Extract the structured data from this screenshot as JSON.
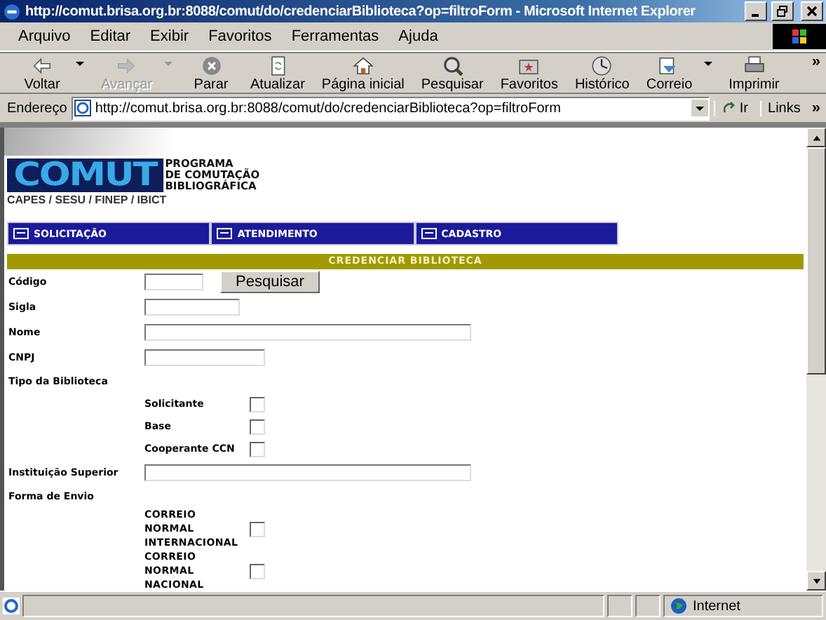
{
  "window": {
    "title": "http://comut.brisa.org.br:8088/comut/do/credenciarBiblioteca?op=filtroForm - Microsoft Internet Explorer"
  },
  "menu": [
    "Arquivo",
    "Editar",
    "Exibir",
    "Favoritos",
    "Ferramentas",
    "Ajuda"
  ],
  "toolbar": [
    {
      "kind": "back",
      "label": "Voltar",
      "disabled": false,
      "dropdown": true
    },
    {
      "kind": "forward",
      "label": "Avançar",
      "disabled": true,
      "dropdown": true
    },
    {
      "kind": "stop",
      "label": "Parar",
      "disabled": false,
      "dropdown": false
    },
    {
      "kind": "refresh",
      "label": "Atualizar",
      "disabled": false,
      "dropdown": false
    },
    {
      "kind": "home",
      "label": "Página inicial",
      "disabled": false,
      "dropdown": false
    },
    {
      "kind": "search",
      "label": "Pesquisar",
      "disabled": false,
      "dropdown": false
    },
    {
      "kind": "favorites",
      "label": "Favoritos",
      "disabled": false,
      "dropdown": false
    },
    {
      "kind": "history",
      "label": "Histórico",
      "disabled": false,
      "dropdown": false
    },
    {
      "kind": "mail",
      "label": "Correio",
      "disabled": false,
      "dropdown": true
    },
    {
      "kind": "print",
      "label": "Imprimir",
      "disabled": false,
      "dropdown": false
    }
  ],
  "toolbar_more": "»",
  "address_bar": {
    "more": "»",
    "label": "Endereço",
    "url": "http://comut.brisa.org.br:8088/comut/do/credenciarBiblioteca?op=filtroForm",
    "go": "Ir",
    "links": "Links"
  },
  "logo": {
    "mark": "COMUT",
    "tagline": [
      "PROGRAMA",
      "DE COMUTAÇÃO",
      "BIBLIOGRÁFICA"
    ],
    "partners": "CAPES / SESU / FINEP / IBICT"
  },
  "nav": [
    "SOLICITAÇÃO",
    "ATENDIMENTO",
    "CADASTRO"
  ],
  "section_title": "CREDENCIAR BIBLIOTECA",
  "form": [
    {
      "kind": "text",
      "label": "Código",
      "button": "Pesquisar"
    },
    {
      "kind": "text",
      "label": "Sigla"
    },
    {
      "kind": "text",
      "label": "Nome"
    },
    {
      "kind": "text",
      "label": "CNPJ"
    },
    {
      "kind": "heading",
      "label": "Tipo da Biblioteca"
    },
    {
      "kind": "checkbox",
      "label": "Solicitante",
      "checked": false
    },
    {
      "kind": "checkbox",
      "label": "Base",
      "checked": false
    },
    {
      "kind": "checkbox",
      "label": "Cooperante CCN",
      "checked": false
    },
    {
      "kind": "text",
      "label": "Instituição Superior"
    },
    {
      "kind": "heading",
      "label": "Forma de Envio"
    },
    {
      "kind": "checkbox",
      "label": "CORREIO NORMAL INTERNACIONAL",
      "checked": false,
      "narrow": true
    },
    {
      "kind": "checkbox",
      "label": "CORREIO NORMAL NACIONAL",
      "checked": false,
      "narrow": true
    }
  ],
  "status_bar": {
    "zone": "Internet"
  }
}
